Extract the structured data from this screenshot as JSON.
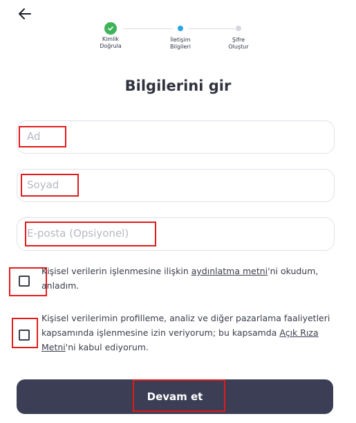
{
  "header": {
    "back_icon": "arrow-left-icon"
  },
  "stepper": {
    "steps": [
      {
        "label": "Kimlik\nDoğrula",
        "state": "done"
      },
      {
        "label": "İletişim\nBilgileri",
        "state": "active"
      },
      {
        "label": "Şifre\nOluştur",
        "state": "pending"
      }
    ]
  },
  "title": "Bilgilerini gir",
  "form": {
    "first_name": {
      "placeholder": "Ad",
      "value": ""
    },
    "last_name": {
      "placeholder": "Soyad",
      "value": ""
    },
    "email": {
      "placeholder": "E-posta (Opsiyonel)",
      "value": ""
    }
  },
  "consents": [
    {
      "checked": false,
      "text_before": "Kişisel verilerin işlenmesine ilişkin ",
      "link": "aydınlatma metni",
      "text_after": "'ni okudum, anladım."
    },
    {
      "checked": false,
      "text_before": "Kişisel verilerimin profilleme, analiz ve diğer pazarlama faaliyetleri kapsamında işlenmesine izin veriyorum; bu kapsamda ",
      "link": "Açık Rıza Metni",
      "text_after": "'ni kabul ediyorum."
    }
  ],
  "submit_label": "Devam et",
  "colors": {
    "primary_button": "#3b3e54",
    "step_done": "#3fb35a",
    "step_active": "#2ba7e8",
    "highlight": "#e21a1a"
  }
}
